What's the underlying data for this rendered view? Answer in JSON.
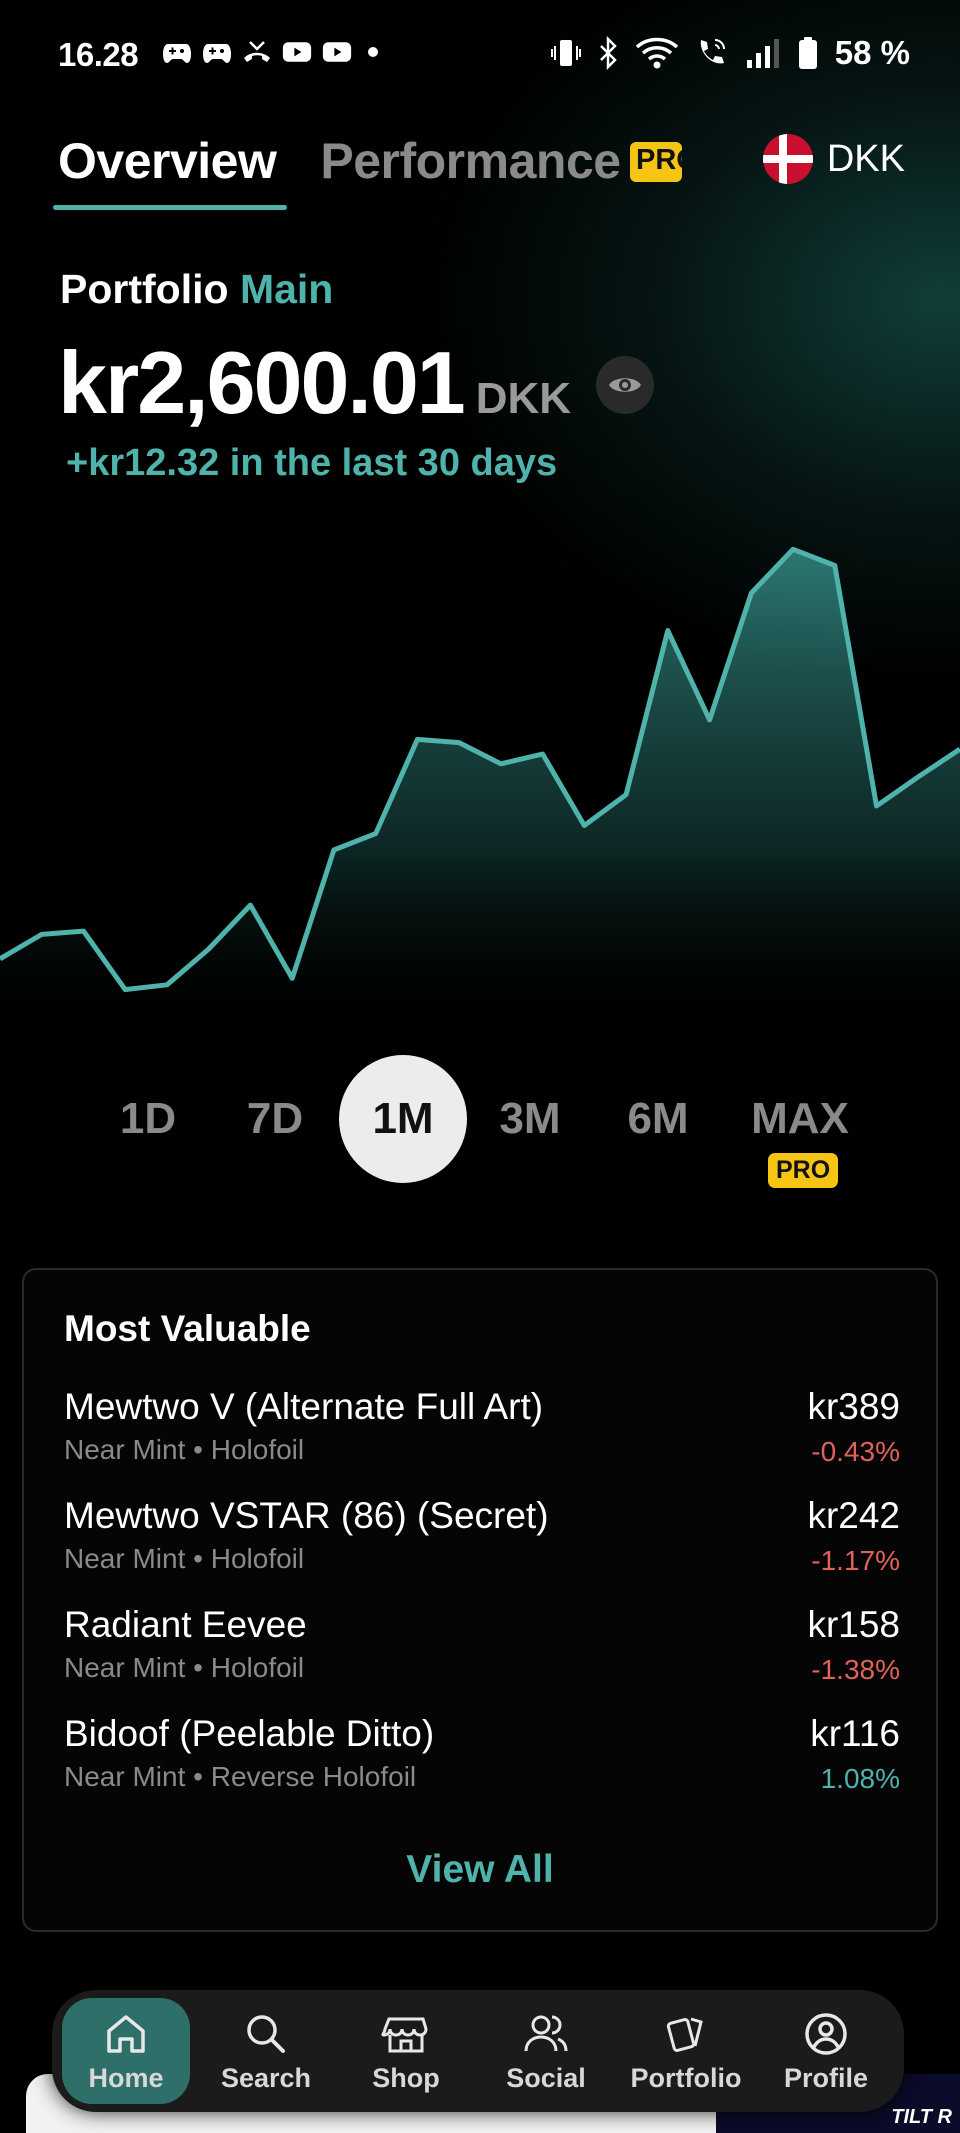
{
  "status_bar": {
    "time": "16.28",
    "battery": "58 %"
  },
  "tabs": {
    "overview": "Overview",
    "performance": "Performance",
    "pro_badge": "PRO"
  },
  "currency": {
    "code": "DKK"
  },
  "portfolio": {
    "label": "Portfolio",
    "name": "Main",
    "total_value": "kr2,600.01",
    "total_unit": "DKK",
    "change": "+kr12.32 in the last 30 days"
  },
  "chart_data": {
    "type": "area",
    "values": [
      2570,
      2585,
      2587,
      2551,
      2554,
      2576,
      2603,
      2558,
      2637,
      2647,
      2705,
      2703,
      2690,
      2696,
      2652,
      2671,
      2772,
      2717,
      2795,
      2822,
      2812,
      2664,
      2682,
      2699
    ],
    "ylim": [
      2520,
      2840
    ],
    "color": "#4fb3ac"
  },
  "ranges": {
    "items": [
      "1D",
      "7D",
      "1M",
      "3M",
      "6M",
      "MAX"
    ],
    "active": "1M",
    "max_badge": "PRO"
  },
  "most_valuable": {
    "title": "Most Valuable",
    "items": [
      {
        "name": "Mewtwo V (Alternate Full Art)",
        "sub": "Near Mint • Holofoil",
        "price": "kr389",
        "change": "-0.43%"
      },
      {
        "name": "Mewtwo VSTAR (86) (Secret)",
        "sub": "Near Mint • Holofoil",
        "price": "kr242",
        "change": "-1.17%"
      },
      {
        "name": "Radiant Eevee",
        "sub": "Near Mint • Holofoil",
        "price": "kr158",
        "change": "-1.38%"
      },
      {
        "name": "Bidoof (Peelable Ditto)",
        "sub": "Near Mint • Reverse Holofoil",
        "price": "kr116",
        "change": "1.08%"
      }
    ],
    "view_all": "View All"
  },
  "nav": {
    "items": [
      "Home",
      "Search",
      "Shop",
      "Social",
      "Portfolio",
      "Profile"
    ],
    "active": "Home"
  },
  "peek_banner_text": "TILT R"
}
